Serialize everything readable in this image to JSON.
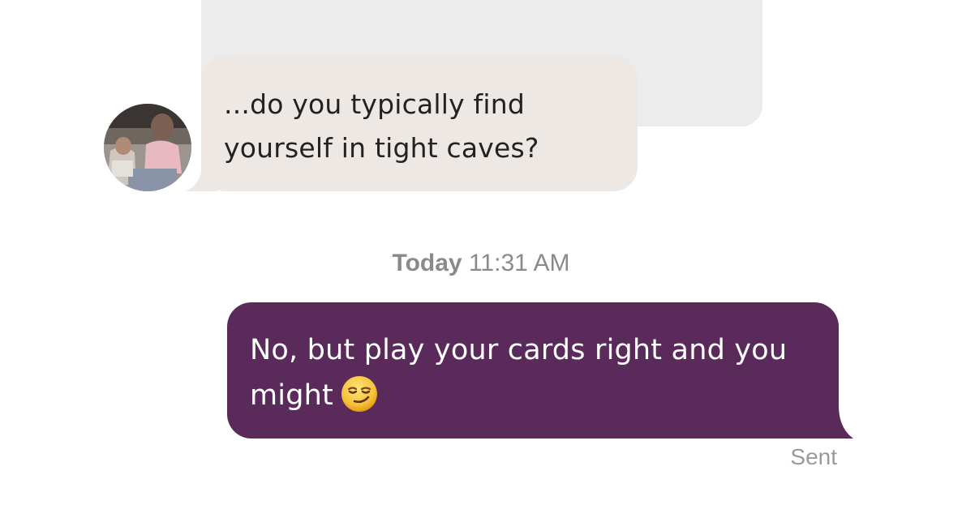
{
  "conversation": {
    "received_message": {
      "text": "...do you typically find yourself in tight caves?"
    },
    "divider": {
      "day": "Today",
      "time": "11:31 AM"
    },
    "sent_message": {
      "text": "No, but play your cards right and you might",
      "emoji": "smirking-face-emoji",
      "status": "Sent"
    }
  },
  "colors": {
    "received_bubble": "#ede8e4",
    "previous_bubble": "#ececed",
    "sent_bubble": "#5a2b5a",
    "meta_text": "#8a8a8a"
  }
}
